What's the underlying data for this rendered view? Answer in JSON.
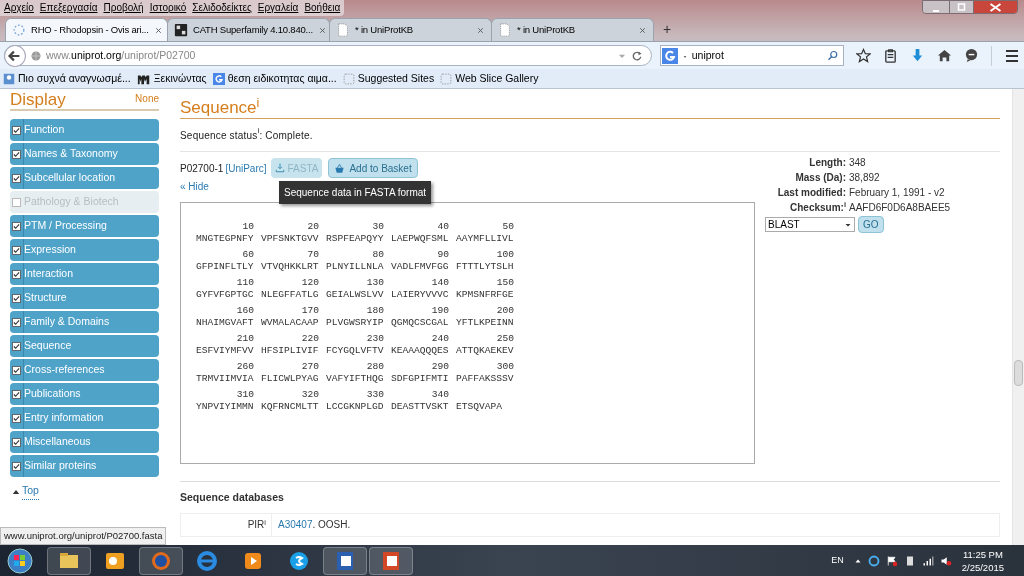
{
  "menu_bar": [
    "Αρχείο",
    "Επεξεργασία",
    "Προβολή",
    "Ιστορικό",
    "Σελιδοδείκτες",
    "Εργαλεία",
    "Βοήθεια"
  ],
  "tabs": [
    {
      "title": "RHO - Rhodopsin - Ovis ari...",
      "selected": true,
      "kind": "loading"
    },
    {
      "title": "CATH Superfamily 4.10.840...",
      "selected": false,
      "kind": "logo"
    },
    {
      "title": "* in UniProtKB",
      "selected": false,
      "kind": "page"
    },
    {
      "title": "* in UniProtKB",
      "selected": false,
      "kind": "page"
    }
  ],
  "new_tab": "+",
  "address": {
    "host": "www.",
    "domain": "uniprot.org",
    "path": "/uniprot/P02700"
  },
  "search": {
    "value": "uniprot"
  },
  "bookmarks": [
    {
      "label": "Πιο συχνά αναγνωσμέ...",
      "kind": "page"
    },
    {
      "label": "Ξεκινώντας",
      "kind": "m"
    },
    {
      "label": "θεση ειδικοτητας αιμα...",
      "kind": "g"
    },
    {
      "label": "Suggested Sites",
      "kind": "box"
    },
    {
      "label": "Web Slice Gallery",
      "kind": "box"
    }
  ],
  "sidebar": {
    "title": "Display",
    "none_link": "None",
    "items": [
      {
        "label": "Function",
        "checked": true
      },
      {
        "label": "Names & Taxonomy",
        "checked": true
      },
      {
        "label": "Subcellular location",
        "checked": true
      },
      {
        "label": "Pathology & Biotech",
        "checked": false
      },
      {
        "label": "PTM / Processing",
        "checked": true
      },
      {
        "label": "Expression",
        "checked": true
      },
      {
        "label": "Interaction",
        "checked": true
      },
      {
        "label": "Structure",
        "checked": true
      },
      {
        "label": "Family & Domains",
        "checked": true
      },
      {
        "label": "Sequence",
        "checked": true
      },
      {
        "label": "Cross-references",
        "checked": true
      },
      {
        "label": "Publications",
        "checked": true
      },
      {
        "label": "Entry information",
        "checked": true
      },
      {
        "label": "Miscellaneous",
        "checked": true
      },
      {
        "label": "Similar proteins",
        "checked": true
      }
    ],
    "top_link": "Top"
  },
  "section": {
    "title": "Sequence$^{i}$",
    "status": "Sequence status$^{i}$: Complete."
  },
  "isoform": {
    "id": "P02700-1",
    "uniparc": "[UniParc]",
    "fasta_button": "FASTA",
    "basket_button": "Add to Basket",
    "hide_link": "« Hide",
    "tooltip": "Sequence data in FASTA format"
  },
  "sequence": [
    {
      "numbers": [
        "10",
        "20",
        "30",
        "40",
        "50"
      ],
      "residues": [
        "MNGTEGPNFY",
        "VPFSNKTGVV",
        "RSPFEAPQYY",
        "LAEPWQFSML",
        "AAYMFLLIVL"
      ]
    },
    {
      "numbers": [
        "60",
        "70",
        "80",
        "90",
        "100"
      ],
      "residues": [
        "GFPINFLTLY",
        "VTVQHKKLRT",
        "PLNYILLNLA",
        "VADLFMVFGG",
        "FTTTLYTSLH"
      ]
    },
    {
      "numbers": [
        "110",
        "120",
        "130",
        "140",
        "150"
      ],
      "residues": [
        "GYFVFGPTGC",
        "NLEGFFATLG",
        "GEIALWSLVV",
        "LAIERYVVVC",
        "KPMSNFRFGE"
      ]
    },
    {
      "numbers": [
        "160",
        "170",
        "180",
        "190",
        "200"
      ],
      "residues": [
        "NHAIMGVAFT",
        "WVMALACAAP",
        "PLVGWSRYIP",
        "QGMQCSCGAL",
        "YFTLKPEINN"
      ]
    },
    {
      "numbers": [
        "210",
        "220",
        "230",
        "240",
        "250"
      ],
      "residues": [
        "ESFVIYMFVV",
        "HFSIPLIVIF",
        "FCYGQLVFTV",
        "KEAAAQQQES",
        "ATTQKAEKEV"
      ]
    },
    {
      "numbers": [
        "260",
        "270",
        "280",
        "290",
        "300"
      ],
      "residues": [
        "TRMVIIMVIA",
        "FLICWLPYAG",
        "VAFYIFTHQG",
        "SDFGPIFMTI",
        "PAFFAKSSSV"
      ]
    },
    {
      "numbers": [
        "310",
        "320",
        "330",
        "340"
      ],
      "residues": [
        "YNPVIYIMMN",
        "KQFRNCMLTT",
        "LCCGKNPLGD",
        "DEASTTVSKT",
        "ETSQVAPA"
      ]
    }
  ],
  "properties": [
    {
      "label": "Length:",
      "value": "348"
    },
    {
      "label": "Mass (Da):",
      "value": "38,892"
    },
    {
      "label": "Last modified:",
      "value": "February 1, 1991 - v2"
    },
    {
      "label": "Checksum:$^{i}$",
      "value": "AAFD6F0D6A8BAEE5"
    }
  ],
  "tool_select": {
    "value": "BLAST"
  },
  "go_button": "GO",
  "databases": {
    "title": "Sequence databases",
    "rows": [
      {
        "label": "PIR$^{i}$",
        "link": "A30407",
        "text": ". OOSH."
      }
    ]
  },
  "status_url": "www.uniprot.org/uniprot/P02700.fasta",
  "taskbar": {
    "language": "EN",
    "time": "11:25 PM",
    "date": "2/25/2015"
  }
}
